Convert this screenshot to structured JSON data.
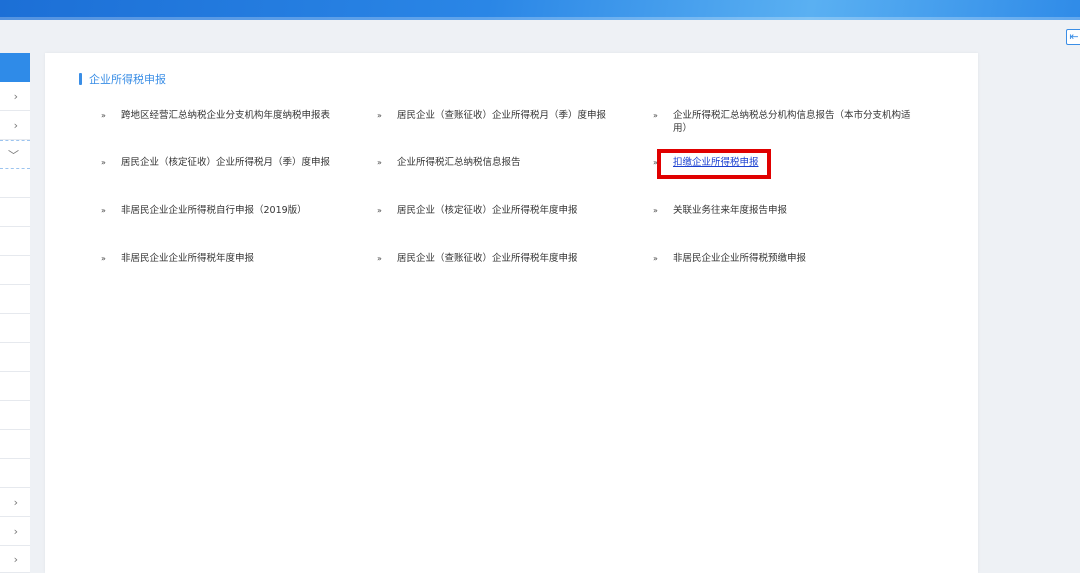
{
  "header": {
    "back_icon": "exit-icon"
  },
  "sidebar": {
    "items": [
      {
        "chevron": "›"
      },
      {
        "chevron": "›"
      },
      {
        "chevron": "⌵"
      },
      {
        "chevron": ""
      },
      {
        "chevron": ""
      },
      {
        "chevron": ""
      },
      {
        "chevron": ""
      },
      {
        "chevron": ""
      },
      {
        "chevron": ""
      },
      {
        "chevron": ""
      },
      {
        "chevron": ""
      },
      {
        "chevron": ""
      },
      {
        "chevron": ""
      },
      {
        "chevron": "›"
      },
      {
        "chevron": "›"
      },
      {
        "chevron": "›"
      }
    ]
  },
  "section": {
    "title": "企业所得税申报"
  },
  "bullet": "»",
  "links": [
    "跨地区经营汇总纳税企业分支机构年度纳税申报表",
    "居民企业（查账征收）企业所得税月（季）度申报",
    "企业所得税汇总纳税总分机构信息报告（本市分支机构适用）",
    "居民企业（核定征收）企业所得税月（季）度申报",
    "企业所得税汇总纳税信息报告",
    "扣缴企业所得税申报",
    "非居民企业企业所得税自行申报（2019版）",
    "居民企业（核定征收）企业所得税年度申报",
    "关联业务往来年度报告申报",
    "非居民企业企业所得税年度申报",
    "居民企业（查账征收）企业所得税年度申报",
    "非居民企业企业所得税预缴申报"
  ],
  "colors": {
    "accent": "#3a8ee6",
    "highlight": "#e00000"
  }
}
